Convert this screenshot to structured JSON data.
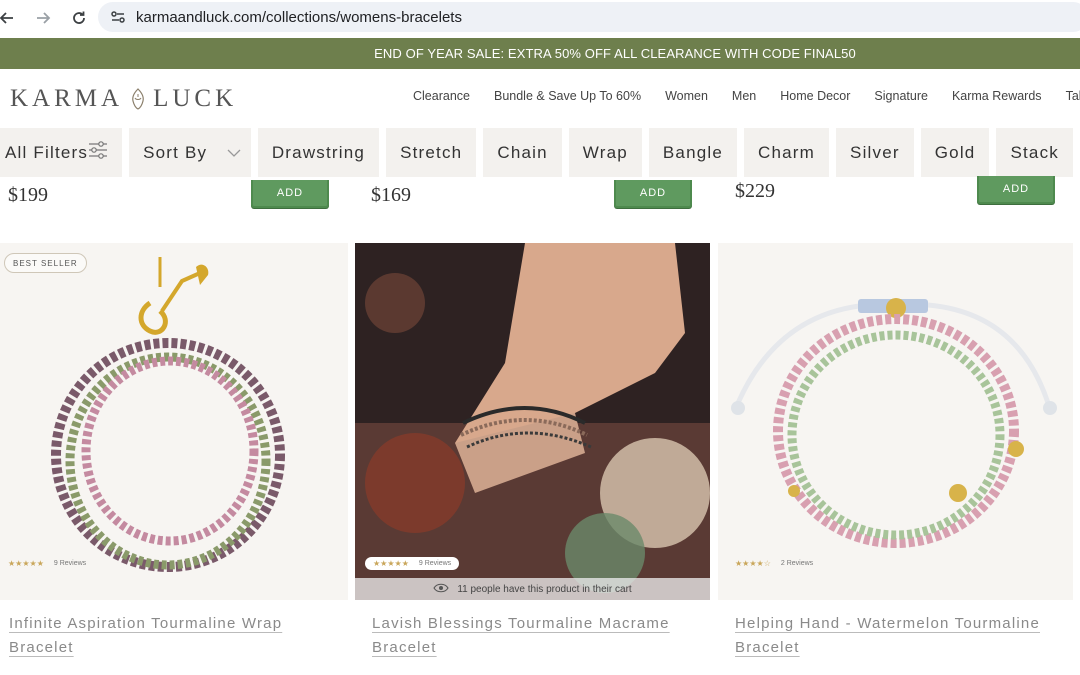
{
  "browser": {
    "url": "karmaandluck.com/collections/womens-bracelets"
  },
  "promo": {
    "text": "END OF YEAR SALE: EXTRA 50% OFF ALL CLEARANCE WITH CODE FINAL50",
    "bg_color": "#6e7f4d"
  },
  "header": {
    "logo_left": "KARMA",
    "logo_right": "LUCK",
    "nav": [
      "Clearance",
      "Bundle & Save Up To 60%",
      "Women",
      "Men",
      "Home Decor",
      "Signature",
      "Karma Rewards",
      "Take Our Q"
    ]
  },
  "filters": {
    "all_filters": "All Filters",
    "sort_by": "Sort By",
    "tags": [
      "Drawstring",
      "Stretch",
      "Chain",
      "Wrap",
      "Bangle",
      "Charm",
      "Silver",
      "Gold",
      "Stack"
    ]
  },
  "prev_row": [
    {
      "price": "$199",
      "add_label": "ADD"
    },
    {
      "price": "$169",
      "add_label": "ADD"
    },
    {
      "price": "$229",
      "add_label": "ADD"
    }
  ],
  "products": [
    {
      "badge": "BEST SELLER",
      "reviews": "9 Reviews",
      "stars": "★★★★★",
      "title_line1": "Infinite Aspiration Tourmaline Wrap",
      "title_line2": "Bracelet"
    },
    {
      "reviews": "9 Reviews",
      "stars": "★★★★★",
      "cart_note": "11 people have this product in their cart",
      "title_line1": "Lavish Blessings Tourmaline Macrame",
      "title_line2": "Bracelet"
    },
    {
      "reviews": "2 Reviews",
      "stars": "★★★★☆",
      "title_line1": "Helping Hand - Watermelon Tourmaline",
      "title_line2": "Bracelet"
    }
  ],
  "colors": {
    "add_button": "#5f9a5f",
    "chip_bg": "#f3f1ee",
    "star_gold": "#c9a65a"
  }
}
